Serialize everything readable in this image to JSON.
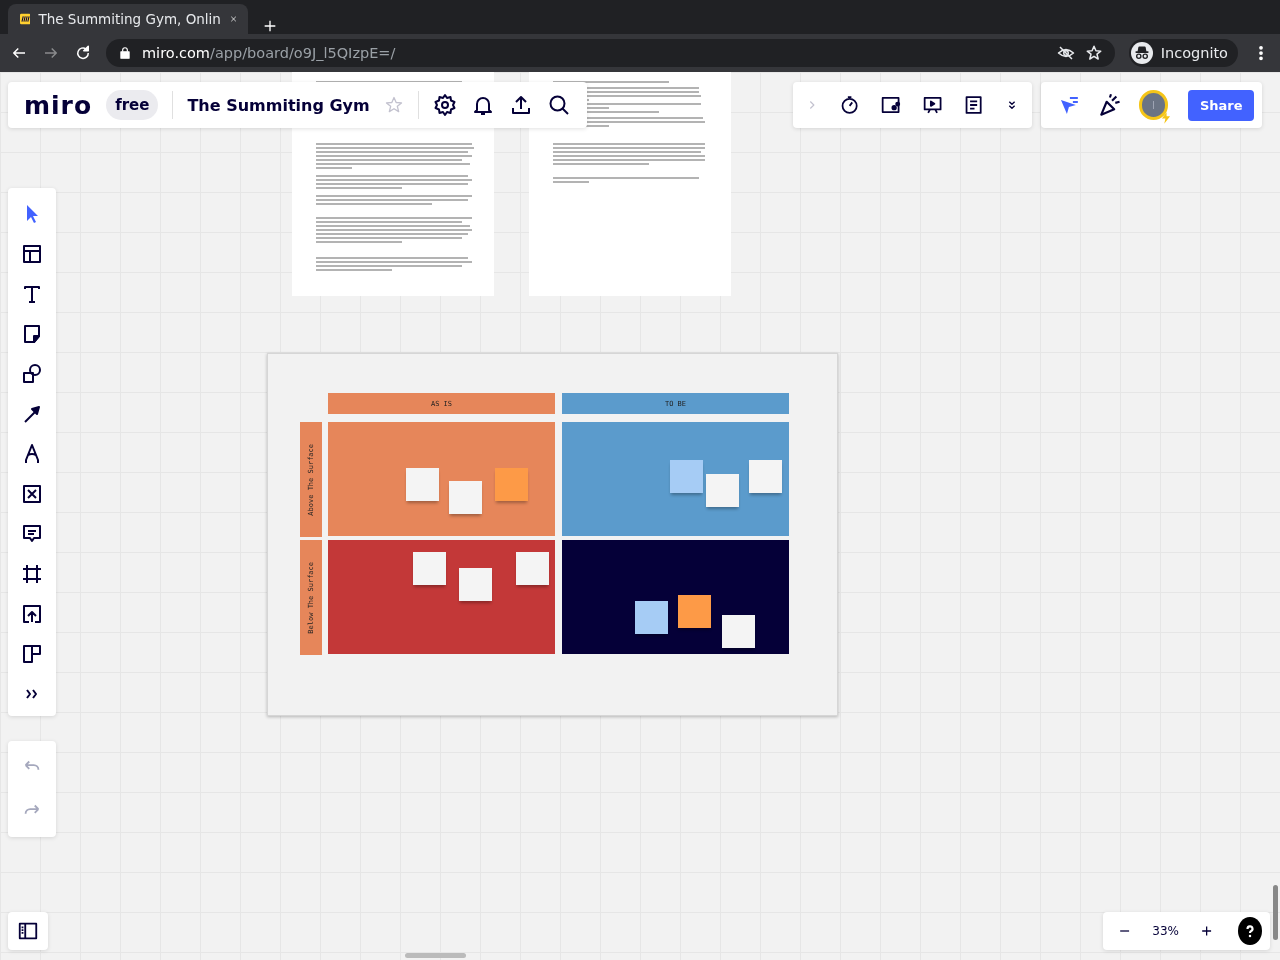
{
  "browser": {
    "tab_title": "The Summiting Gym, Onlin",
    "address": "miro.com/app/board/o9J_l5QIzpE=/",
    "profile": "Incognito"
  },
  "board": {
    "logo": "miro",
    "plan": "free",
    "title": "The Summiting Gym",
    "starred": false
  },
  "collaboration": {
    "avatar_initial": "I",
    "share": "Share"
  },
  "tools": [
    {
      "kind": "select",
      "selected": true
    },
    {
      "kind": "templates",
      "selected": false
    },
    {
      "kind": "text",
      "selected": false
    },
    {
      "kind": "sticky",
      "selected": false
    },
    {
      "kind": "shapes",
      "selected": false
    },
    {
      "kind": "arrow",
      "selected": false
    },
    {
      "kind": "pen",
      "selected": false
    },
    {
      "kind": "crossbox",
      "selected": false
    },
    {
      "kind": "comment",
      "selected": false
    },
    {
      "kind": "frame",
      "selected": false
    },
    {
      "kind": "upload",
      "selected": false
    },
    {
      "kind": "kanban",
      "selected": false
    },
    {
      "kind": "more",
      "selected": false
    }
  ],
  "history": [
    {
      "kind": "undo",
      "disabled": true
    },
    {
      "kind": "redo",
      "disabled": true
    }
  ],
  "matrix": {
    "columns": [
      {
        "label": "AS IS",
        "color": "#e6865a"
      },
      {
        "label": "TO BE",
        "color": "#5b9bcc"
      }
    ],
    "rows": [
      {
        "label": "Above The Surface",
        "color": "#e6865a"
      },
      {
        "label": "Below The Surface",
        "color": "#e6865a"
      }
    ],
    "cells": [
      {
        "color": "#e6865a",
        "notes": [
          {
            "color": "#f4f4f4"
          },
          {
            "color": "#f4f4f4"
          },
          {
            "color": "#fd9a47"
          }
        ]
      },
      {
        "color": "#5b9bcc",
        "notes": [
          {
            "color": "#a6ccf5"
          },
          {
            "color": "#f4f4f4"
          },
          {
            "color": "#f4f4f4"
          }
        ]
      },
      {
        "color": "#c33838",
        "notes": [
          {
            "color": "#f4f4f4"
          },
          {
            "color": "#f4f4f4"
          },
          {
            "color": "#f4f4f4"
          }
        ]
      },
      {
        "color": "#050038",
        "notes": [
          {
            "color": "#a6ccf5"
          },
          {
            "color": "#fd9a47"
          },
          {
            "color": "#f4f4f4"
          }
        ]
      }
    ]
  },
  "zoom": {
    "value": "33%"
  }
}
